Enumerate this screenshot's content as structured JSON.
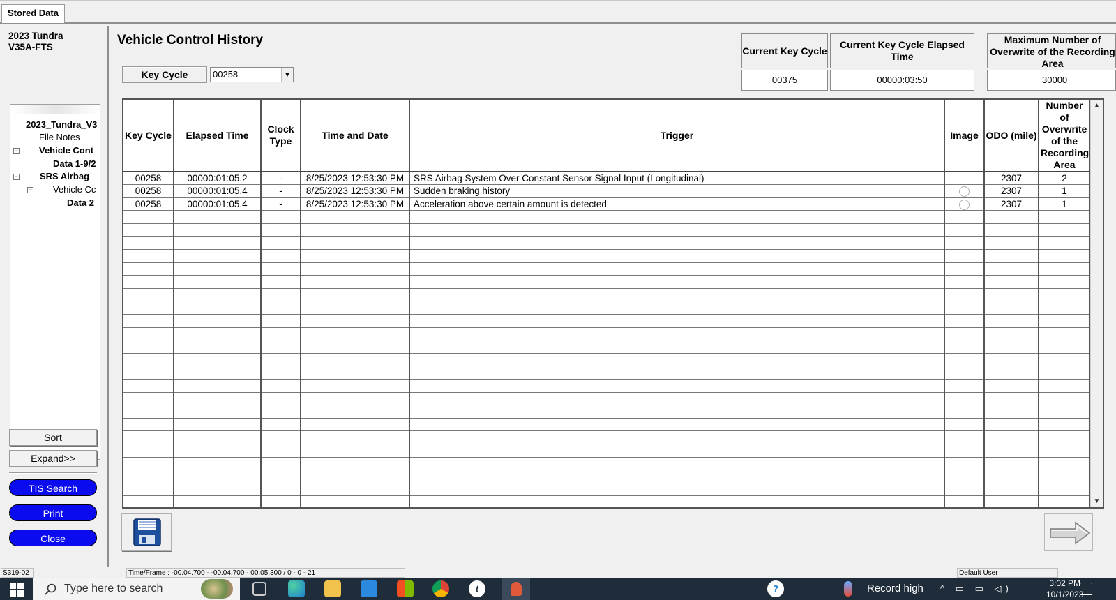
{
  "tab": {
    "label": "Stored Data"
  },
  "vehicle": {
    "model": "2023 Tundra",
    "code": "V35A-FTS"
  },
  "tree": {
    "items": [
      "2023_Tundra_V3",
      "File Notes",
      "Vehicle Cont",
      "Data 1-9/2",
      "SRS Airbag",
      "Vehicle Cc",
      "Data 2"
    ],
    "toggle_symbol": "⊟"
  },
  "left_buttons": {
    "sort": "Sort",
    "expand": "Expand>>",
    "tis_search": "TIS Search",
    "print": "Print",
    "close": "Close"
  },
  "page": {
    "title": "Vehicle Control History"
  },
  "key_cycle_filter": {
    "label": "Key Cycle",
    "value": "00258"
  },
  "info": {
    "current_key_cycle": {
      "label": "Current Key Cycle",
      "value": "00375"
    },
    "elapsed_time": {
      "label": "Current Key Cycle Elapsed Time",
      "value": "00000:03:50"
    },
    "max_overwrite": {
      "label": "Maximum Number of Overwrite of the Recording Area",
      "value": "30000"
    }
  },
  "table": {
    "headers": [
      "Key Cycle",
      "Elapsed Time",
      "Clock Type",
      "Time and Date",
      "Trigger",
      "Image",
      "ODO (mile)",
      "Number of Overwrite of the Recording Area"
    ],
    "rows": [
      [
        "00258",
        "00000:01:05.2",
        "-",
        "8/25/2023 12:53:30 PM",
        "SRS Airbag System Over Constant Sensor Signal Input (Longitudinal)",
        "",
        "2307",
        "2"
      ],
      [
        "00258",
        "00000:01:05.4",
        "-",
        "8/25/2023 12:53:30 PM",
        "Sudden braking history",
        "circle",
        "2307",
        "1"
      ],
      [
        "00258",
        "00000:01:05.4",
        "-",
        "8/25/2023 12:53:30 PM",
        "Acceleration above certain amount is detected",
        "circle",
        "2307",
        "1"
      ]
    ]
  },
  "status": {
    "code": "S319-02",
    "frame": "Time/Frame : -00.04.700 - -00.04.700 - 00.05.300 / 0 - 0 - 21",
    "user": "Default User"
  },
  "taskbar": {
    "search_placeholder": "Type here to search",
    "weather": "Record high",
    "time": "3:02 PM",
    "date": "10/1/2023"
  },
  "colors": {
    "accent_blue": "#0b0bf0",
    "taskbar": "#1f2d3b"
  }
}
